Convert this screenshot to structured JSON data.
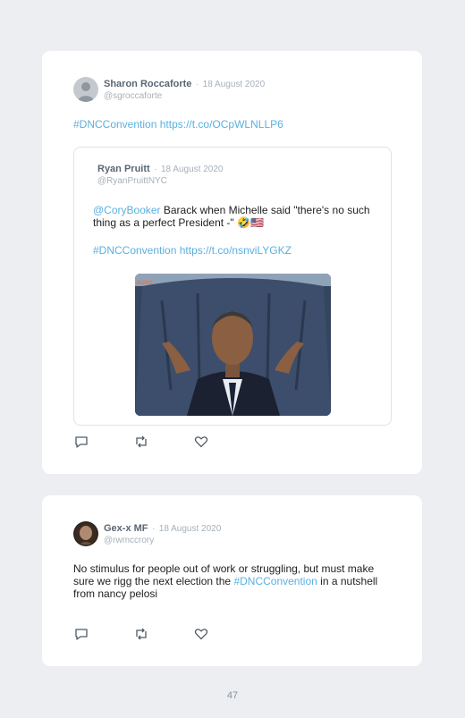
{
  "tweet1": {
    "author": "Sharon Roccaforte",
    "separator": "·",
    "date": "18 August 2020",
    "handle": "@sgroccaforte",
    "hashtag": "#DNCConvention",
    "link": "https://t.co/OCpWLNLLP6",
    "quoted": {
      "author": "Ryan Pruitt",
      "separator": "·",
      "date": "18 August 2020",
      "handle": "@RyanPruittNYC",
      "mention": "@CoryBooker",
      "text": " Barack when Michelle said \"there's no such thing as a perfect President -\" 🤣🇺🇸",
      "hashtag": "#DNCConvention",
      "link": "https://t.co/nsnviLYGKZ",
      "image_watermark": "BURO"
    },
    "actions": [
      "reply-icon",
      "retweet-icon",
      "like-icon"
    ]
  },
  "tweet2": {
    "author": "Gex-x MF",
    "separator": "·",
    "date": "18 August 2020",
    "handle": "@rwmccrory",
    "text_before": "No stimulus for people out of work or struggling, but must make sure we rigg the next election the ",
    "hashtag": "#DNCConvention",
    "text_after": " in a nutshell from nancy pelosi",
    "actions": [
      "reply-icon",
      "retweet-icon",
      "like-icon"
    ]
  },
  "page_number": "47",
  "colors": {
    "link": "#5ab0e0",
    "background": "#eceef1",
    "card": "#ffffff",
    "muted": "#a7b0ba"
  }
}
